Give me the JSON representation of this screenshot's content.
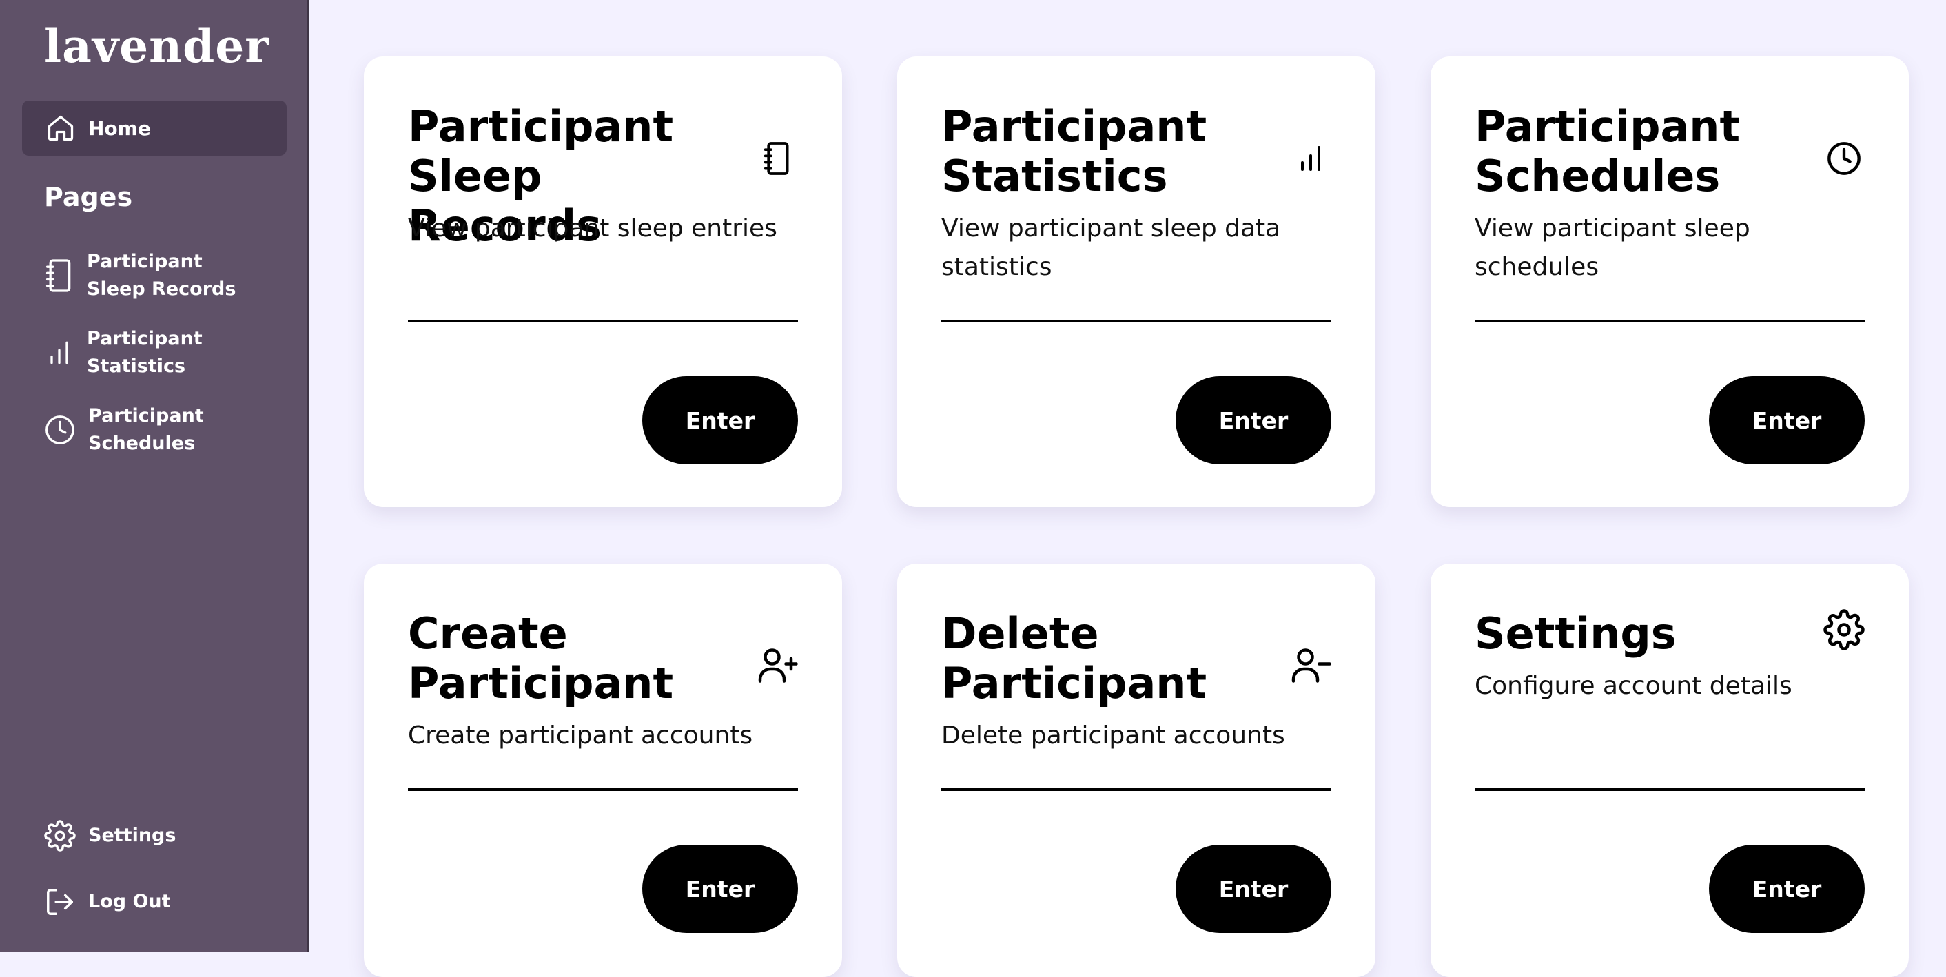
{
  "app": {
    "logo": "lavender"
  },
  "sidebar": {
    "home_label": "Home",
    "pages_heading": "Pages",
    "items": [
      {
        "label": "Participant Sleep Records",
        "icon": "notebook-icon"
      },
      {
        "label": "Participant Statistics",
        "icon": "bar-chart-icon"
      },
      {
        "label": "Participant Schedules",
        "icon": "clock-icon"
      }
    ],
    "settings_label": "Settings",
    "logout_label": "Log Out"
  },
  "cards": [
    {
      "title": "Participant Sleep Records",
      "description": "View participant sleep entries",
      "button": "Enter",
      "icon": "notebook-icon"
    },
    {
      "title": "Participant Statistics",
      "description": "View participant sleep data statistics",
      "button": "Enter",
      "icon": "bar-chart-icon"
    },
    {
      "title": "Participant Schedules",
      "description": "View participant sleep schedules",
      "button": "Enter",
      "icon": "clock-icon"
    },
    {
      "title": "Create Participant",
      "description": "Create participant accounts",
      "button": "Enter",
      "icon": "user-plus-icon"
    },
    {
      "title": "Delete Participant",
      "description": "Delete participant accounts",
      "button": "Enter",
      "icon": "user-minus-icon"
    },
    {
      "title": "Settings",
      "description": "Configure account details",
      "button": "Enter",
      "icon": "gear-icon"
    }
  ],
  "colors": {
    "sidebar": "#5f5168",
    "sidebar_active": "#4a3d53",
    "background": "#f3f1ff",
    "button": "#000000"
  }
}
